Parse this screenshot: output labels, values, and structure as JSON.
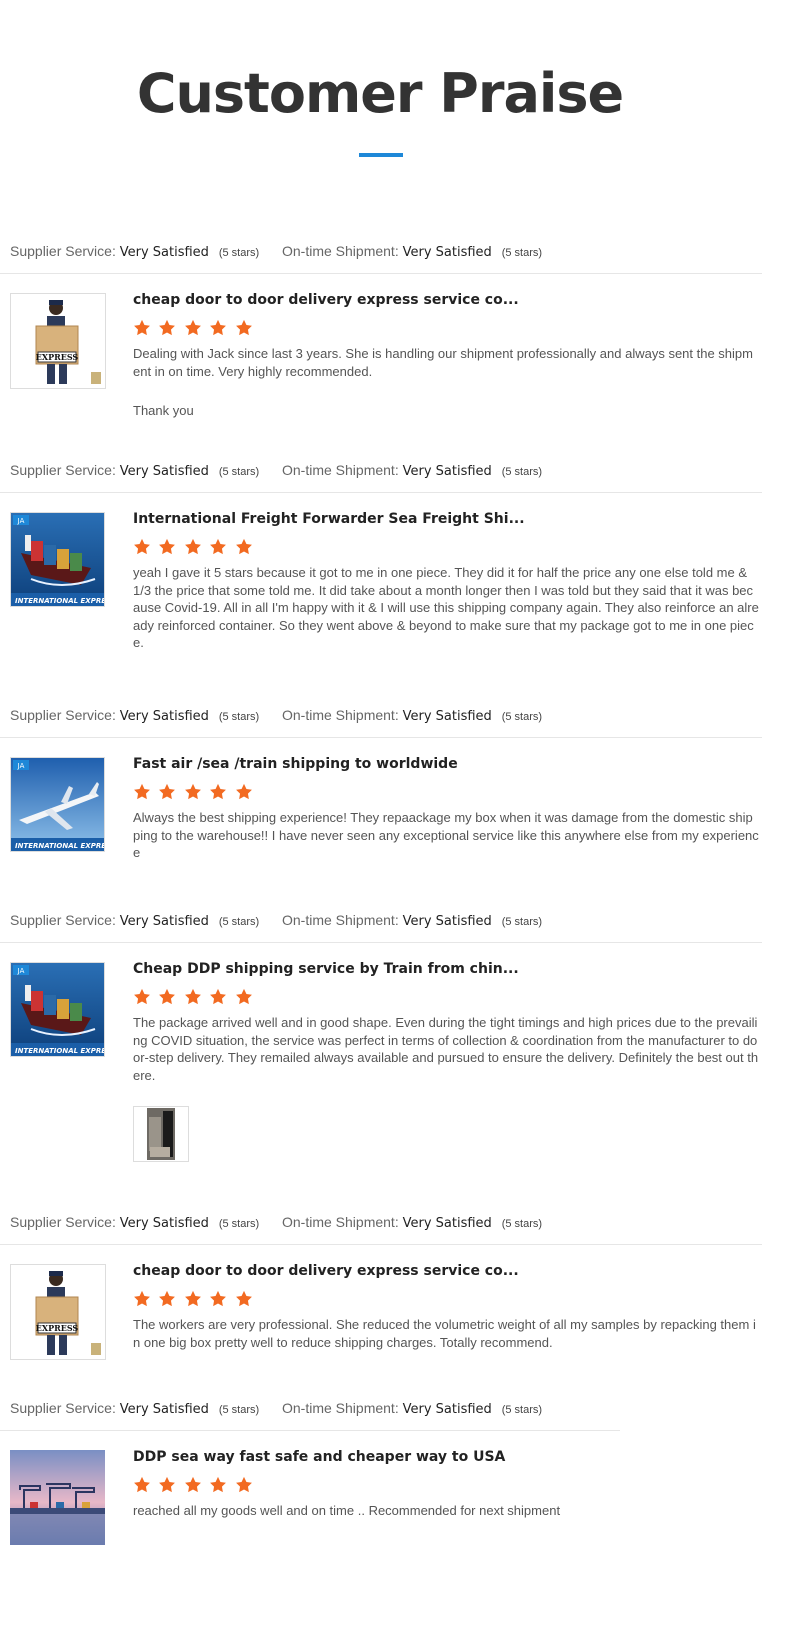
{
  "page": {
    "title": "Customer Praise"
  },
  "labels": {
    "supplier": "Supplier Service:",
    "ontime": "On-time Shipment:"
  },
  "colors": {
    "accent": "#1e88d8",
    "star": "#f26a21"
  },
  "reviews": [
    {
      "supplier_value": "Very Satisfied",
      "supplier_stars": "(5 stars)",
      "ontime_value": "Very Satisfied",
      "ontime_stars": "(5 stars)",
      "product": "cheap door to door delivery express service co...",
      "thumb_icon": "express-box-person-icon",
      "rating": 5,
      "comment": "Dealing with Jack since last 3 years. She is handling our shipment professionally and always sent the shipment in on time. Very highly recommended.",
      "extra": "Thank you"
    },
    {
      "supplier_value": "Very Satisfied",
      "supplier_stars": "(5 stars)",
      "ontime_value": "Very Satisfied",
      "ontime_stars": "(5 stars)",
      "product": "International Freight Forwarder Sea Freight Shi...",
      "thumb_icon": "container-ship-icon",
      "thumb_caption": "INTERNATIONAL EXPRESS",
      "rating": 5,
      "comment": "yeah I gave it 5 stars because it got to me in one piece. They did it for half the price any one else told me & 1/3 the price that some told me. It did take about a month longer then I was told but they said that it was because Covid-19. All in all I'm happy with it & I will use this shipping company again. They also reinforce an already reinforced container. So they went above & beyond to make sure that my package got to me in one piece."
    },
    {
      "supplier_value": "Very Satisfied",
      "supplier_stars": "(5 stars)",
      "ontime_value": "Very Satisfied",
      "ontime_stars": "(5 stars)",
      "product": "Fast air /sea /train shipping to worldwide",
      "thumb_icon": "airplane-icon",
      "thumb_caption": "INTERNATIONAL EXPRESS",
      "rating": 5,
      "comment": "Always the best shipping experience! They repaackage my box when it was damage from the domestic shipping to the warehouse!! I have never seen any exceptional service like this anywhere else from my experience"
    },
    {
      "supplier_value": "Very Satisfied",
      "supplier_stars": "(5 stars)",
      "ontime_value": "Very Satisfied",
      "ontime_stars": "(5 stars)",
      "product": "Cheap DDP shipping service by Train from chin...",
      "thumb_icon": "container-ship-icon",
      "thumb_caption": "INTERNATIONAL EXPRESS",
      "rating": 5,
      "comment": "The package arrived well and in good shape.  Even during the tight timings and high prices due to the prevailing COVID situation, the service was perfect in terms of collection & coordination from the manufacturer to door-step delivery. They remailed always available and pursued to ensure the delivery.  Definitely the best out there.",
      "attachment_icon": "package-photo-icon"
    },
    {
      "supplier_value": "Very Satisfied",
      "supplier_stars": "(5 stars)",
      "ontime_value": "Very Satisfied",
      "ontime_stars": "(5 stars)",
      "product": "cheap door to door delivery express service co...",
      "thumb_icon": "express-box-person-icon",
      "rating": 5,
      "comment": "The workers are very professional. She reduced the volumetric weight of all my samples by repacking them in one big box pretty well to reduce shipping charges. Totally recommend."
    },
    {
      "supplier_value": "Very Satisfied",
      "supplier_stars": "(5 stars)",
      "ontime_value": "Very Satisfied",
      "ontime_stars": "(5 stars)",
      "product": "DDP sea way fast safe and cheaper way to USA",
      "thumb_icon": "port-cranes-icon",
      "rating": 5,
      "comment": "reached all my goods well and on time .. Recommended for next shipment"
    }
  ]
}
